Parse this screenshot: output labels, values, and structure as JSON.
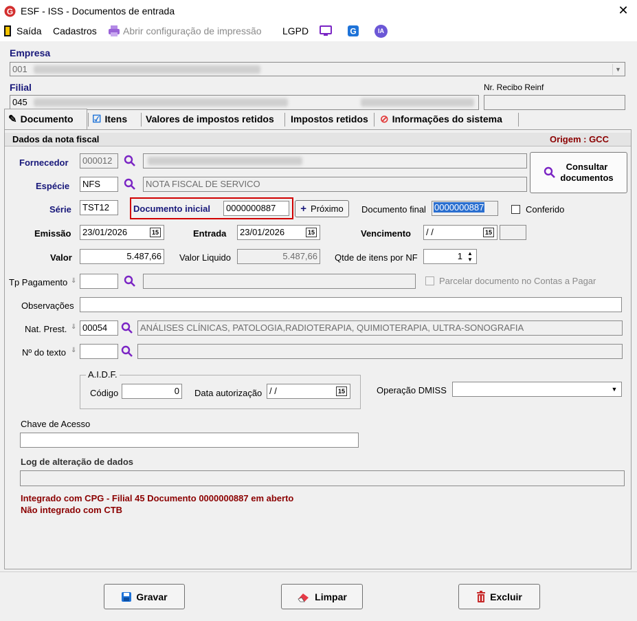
{
  "window": {
    "title": "ESF - ISS - Documentos de entrada"
  },
  "menu": {
    "saida": "Saída",
    "cadastros": "Cadastros",
    "abrir_config": "Abrir configuração de impressão",
    "lgpd": "LGPD",
    "ia": "IA"
  },
  "header": {
    "empresa_label": "Empresa",
    "empresa_code": "001",
    "filial_label": "Filial",
    "filial_code": "045",
    "recibo_label": "Nr. Recibo Reinf",
    "recibo_value": ""
  },
  "tabs": [
    {
      "label": "Documento"
    },
    {
      "label": "Itens"
    },
    {
      "label": "Valores de impostos retidos"
    },
    {
      "label": "Impostos retidos"
    },
    {
      "label": "Informações do sistema"
    }
  ],
  "section": {
    "title": "Dados da nota fiscal",
    "origem": "Origem : GCC"
  },
  "form": {
    "fornecedor_label": "Fornecedor",
    "fornecedor_code": "000012",
    "especie_label": "Espécie",
    "especie_code": "NFS",
    "especie_desc": "NOTA FISCAL DE SERVICO",
    "serie_label": "Série",
    "serie_value": "TST12",
    "doc_inicial_label": "Documento inicial",
    "doc_inicial_value": "0000000887",
    "proximo_label": "Próximo",
    "doc_final_label": "Documento final",
    "doc_final_value": "0000000887",
    "conferido_label": "Conferido",
    "emissao_label": "Emissão",
    "emissao_value": "23/01/2026",
    "entrada_label": "Entrada",
    "entrada_value": "23/01/2026",
    "vencimento_label": "Vencimento",
    "vencimento_value": " / /",
    "valor_label": "Valor",
    "valor_value": "5.487,66",
    "valor_liquido_label": "Valor Liquido",
    "valor_liquido_value": "5.487,66",
    "qtde_label": "Qtde de itens por NF",
    "qtde_value": "1",
    "tp_pagamento_label": "Tp Pagamento",
    "parcelar_label": "Parcelar documento no Contas a Pagar",
    "observacoes_label": "Observações",
    "nat_prest_label": "Nat. Prest.",
    "nat_prest_code": "00054",
    "nat_prest_desc": "ANÁLISES CLÍNICAS, PATOLOGIA,RADIOTERAPIA, QUIMIOTERAPIA, ULTRA-SONOGRAFIA",
    "num_texto_label": "Nº do texto",
    "aidf_label": "A.I.D.F.",
    "codigo_label": "Código",
    "codigo_value": "0",
    "data_aut_label": "Data autorização",
    "data_aut_value": " / /",
    "operacao_label": "Operação DMISS",
    "chave_label": "Chave de Acesso",
    "log_label": "Log de alteração de dados",
    "calendar_glyph": "15"
  },
  "consultar": {
    "line1": "Consultar",
    "line2": "documentos"
  },
  "status": {
    "line1": "Integrado com CPG - Filial 45 Documento 0000000887 em aberto",
    "line2": "Não integrado com CTB"
  },
  "footer": {
    "gravar": "Gravar",
    "limpar": "Limpar",
    "excluir": "Excluir"
  },
  "colors": {
    "accent": "#17177a",
    "status_red": "#8b0000",
    "highlight": "#d00000",
    "purple": "#7a24c4"
  }
}
